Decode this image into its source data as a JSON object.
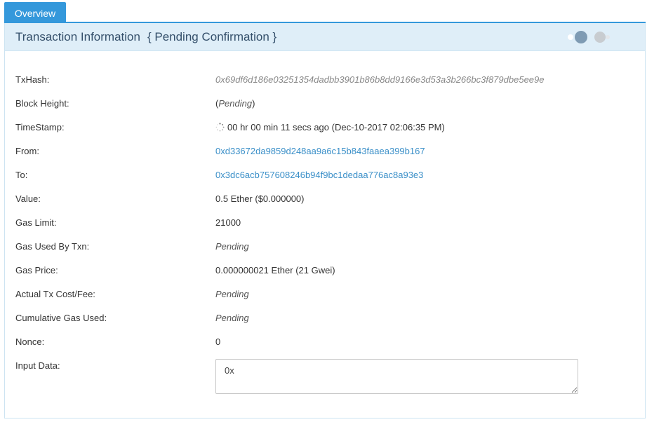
{
  "tabs": [
    {
      "label": "Overview",
      "active": true
    }
  ],
  "panel": {
    "title": "Transaction Information",
    "subtitle": "{ Pending Confirmation }"
  },
  "fields": {
    "txhash": {
      "label": "TxHash:",
      "value": "0x69df6d186e03251354dadbb3901b86b8dd9166e3d53a3b266bc3f879dbe5ee9e"
    },
    "block_height": {
      "label": "Block Height:",
      "prefix": "(",
      "value": "Pending",
      "suffix": ")"
    },
    "timestamp": {
      "label": "TimeStamp:",
      "elapsed": "00 hr 00 min 11 secs ago",
      "datetime": "(Dec-10-2017 02:06:35 PM)"
    },
    "from": {
      "label": "From:",
      "value": "0xd33672da9859d248aa9a6c15b843faaea399b167"
    },
    "to": {
      "label": "To:",
      "value": "0x3dc6acb757608246b94f9bc1dedaa776ac8a93e3"
    },
    "value": {
      "label": "Value:",
      "value": "0.5 Ether ($0.000000)"
    },
    "gas_limit": {
      "label": "Gas Limit:",
      "value": "21000"
    },
    "gas_used": {
      "label": "Gas Used By Txn:",
      "value": "Pending"
    },
    "gas_price": {
      "label": "Gas Price:",
      "value": "0.000000021 Ether (21 Gwei)"
    },
    "tx_fee": {
      "label": "Actual Tx Cost/Fee:",
      "value": "Pending"
    },
    "cumulative_gas": {
      "label": "Cumulative Gas Used:",
      "value": "Pending"
    },
    "nonce": {
      "label": "Nonce:",
      "value": "0"
    },
    "input_data": {
      "label": "Input Data:",
      "value": "0x"
    }
  },
  "colors": {
    "accent": "#3498db",
    "header_bg": "#dfeef8",
    "link": "#3a8fc8"
  },
  "icons": {
    "loader": "loading-dots-icon",
    "timestamp": "spinner-icon"
  }
}
